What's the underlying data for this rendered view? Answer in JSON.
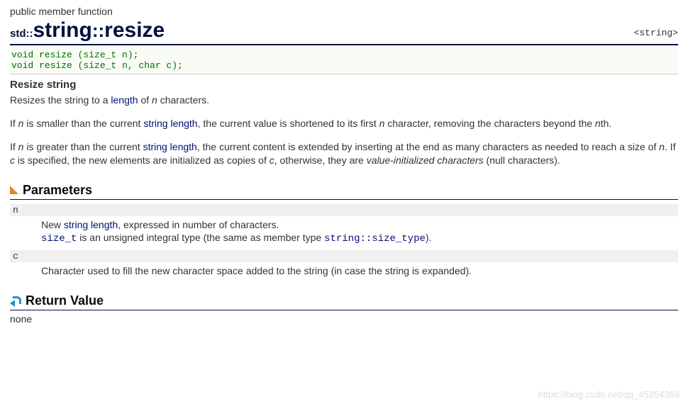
{
  "category": "public member function",
  "header_tag": "<string>",
  "title": {
    "std": "std::",
    "cls": "string",
    "sep": "::",
    "fn": "resize"
  },
  "signatures": "void resize (size_t n);\nvoid resize (size_t n, char c);",
  "short_desc": "Resize string",
  "para1": {
    "a": "Resizes the string to a ",
    "link": "length",
    "b": " of ",
    "n": "n",
    "c": " characters."
  },
  "para2": {
    "a": "If ",
    "n1": "n",
    "b": " is smaller than the current ",
    "link": "string length",
    "c": ", the current value is shortened to its first ",
    "n2": "n",
    "d": " character, removing the characters beyond the ",
    "n3": "n",
    "e": "th."
  },
  "para3": {
    "a": "If ",
    "n1": "n",
    "b": " is greater than the current ",
    "link": "string length",
    "c": ", the current content is extended by inserting at the end as many characters as needed to reach a size of ",
    "n2": "n",
    "d": ". If ",
    "cvar": "c",
    "e": " is specified, the new elements are initialized as copies of ",
    "cvar2": "c",
    "f": ", otherwise, they are ",
    "vi": "value-initialized characters",
    "g": " (null characters)."
  },
  "sections": {
    "params": {
      "title": "Parameters",
      "items": {
        "n": {
          "term": "n",
          "line1a": "New ",
          "line1link": "string length",
          "line1b": ", expressed in number of characters.",
          "line2a": "size_t",
          "line2b": " is an unsigned integral type (the same as member type ",
          "line2c": "string::size_type",
          "line2d": ")."
        },
        "c": {
          "term": "c",
          "desc": "Character used to fill the new character space added to the string (in case the string is expanded)."
        }
      }
    },
    "retval": {
      "title": "Return Value",
      "text": "none"
    }
  },
  "watermark": "https://blog.csdn.net/qq_45254369"
}
